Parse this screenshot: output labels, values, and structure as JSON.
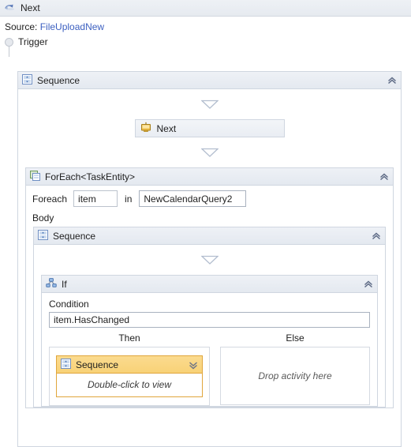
{
  "window": {
    "title": "Next",
    "icon": "workflow-activity-icon"
  },
  "source": {
    "label": "Source:",
    "value": "FileUploadNew"
  },
  "trigger": {
    "label": "Trigger"
  },
  "colors": {
    "accent_link": "#3b5fc0",
    "selection_border": "#e0a63c",
    "selection_header_top": "#fbdb8f",
    "selection_header_bottom": "#f8d277",
    "panel_border": "#cfd6e0",
    "header_top": "#eef1f6",
    "header_bottom": "#e4e9f0"
  },
  "root_sequence": {
    "title": "Sequence",
    "icon": "sequence-icon",
    "collapse_chevron": "chevron-up-double-icon",
    "activity": {
      "title": "Next",
      "icon": "next-activity-icon"
    }
  },
  "foreach": {
    "title": "ForEach<TaskEntity>",
    "icon": "foreach-icon",
    "collapse_chevron": "chevron-up-double-icon",
    "prefix_label": "Foreach",
    "variable": "item",
    "in_label": "in",
    "collection": "NewCalendarQuery2",
    "body_label": "Body"
  },
  "inner_sequence": {
    "title": "Sequence",
    "icon": "sequence-icon",
    "collapse_chevron": "chevron-up-double-icon"
  },
  "if_activity": {
    "title": "If",
    "icon": "if-branch-icon",
    "collapse_chevron": "chevron-up-double-icon",
    "condition_label": "Condition",
    "condition_value": "item.HasChanged",
    "then_label": "Then",
    "else_label": "Else",
    "then_branch": {
      "sequence_title": "Sequence",
      "sequence_icon": "sequence-icon",
      "expand_chevron": "chevron-down-double-icon",
      "note": "Double-click to view"
    },
    "else_branch": {
      "drop_hint": "Drop activity here"
    }
  }
}
